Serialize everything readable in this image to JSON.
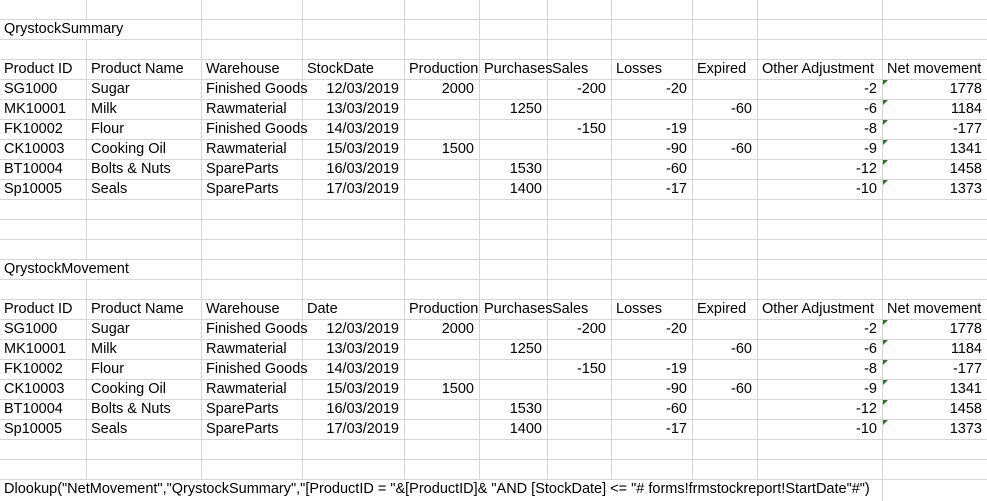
{
  "colors": {
    "gridline": "#d6d6d6",
    "flag_green": "#1e7b1e",
    "text": "#000000",
    "background": "#ffffff"
  },
  "icons": {
    "error_flag": "green-corner-triangle"
  },
  "sheet": {
    "tables": [
      {
        "title": "QrystockSummary",
        "headers": [
          "Product ID",
          "Product Name",
          "Warehouse",
          "StockDate",
          "Production",
          "Purchases",
          "Sales",
          "Losses",
          "Expired",
          "Other Adjustment",
          "Net movement"
        ],
        "rows": [
          [
            "SG1000",
            "Sugar",
            "Finished Goods",
            "12/03/2019",
            "2000",
            "",
            "-200",
            "-20",
            "",
            "-2",
            "1778"
          ],
          [
            "MK10001",
            "Milk",
            "Rawmaterial",
            "13/03/2019",
            "",
            "1250",
            "",
            "",
            "-60",
            "-6",
            "1184"
          ],
          [
            "FK10002",
            "Flour",
            "Finished Goods",
            "14/03/2019",
            "",
            "",
            "-150",
            "-19",
            "",
            "-8",
            "-177"
          ],
          [
            "CK10003",
            "Cooking Oil",
            "Rawmaterial",
            "15/03/2019",
            "1500",
            "",
            "",
            "-90",
            "-60",
            "-9",
            "1341"
          ],
          [
            "BT10004",
            "Bolts & Nuts",
            "SpareParts",
            "16/03/2019",
            "",
            "1530",
            "",
            "-60",
            "",
            "-12",
            "1458"
          ],
          [
            "Sp10005",
            "Seals",
            "SpareParts",
            "17/03/2019",
            "",
            "1400",
            "",
            "-17",
            "",
            "-10",
            "1373"
          ]
        ]
      },
      {
        "title": "QrystockMovement",
        "headers": [
          "Product ID",
          "Product Name",
          "Warehouse",
          "Date",
          "Production",
          "Purchases",
          "Sales",
          "Losses",
          "Expired",
          "Other Adjustment",
          "Net movement"
        ],
        "rows": [
          [
            "SG1000",
            "Sugar",
            "Finished Goods",
            "12/03/2019",
            "2000",
            "",
            "-200",
            "-20",
            "",
            "-2",
            "1778"
          ],
          [
            "MK10001",
            "Milk",
            "Rawmaterial",
            "13/03/2019",
            "",
            "1250",
            "",
            "",
            "-60",
            "-6",
            "1184"
          ],
          [
            "FK10002",
            "Flour",
            "Finished Goods",
            "14/03/2019",
            "",
            "",
            "-150",
            "-19",
            "",
            "-8",
            "-177"
          ],
          [
            "CK10003",
            "Cooking Oil",
            "Rawmaterial",
            "15/03/2019",
            "1500",
            "",
            "",
            "-90",
            "-60",
            "-9",
            "1341"
          ],
          [
            "BT10004",
            "Bolts & Nuts",
            "SpareParts",
            "16/03/2019",
            "",
            "1530",
            "",
            "-60",
            "",
            "-12",
            "1458"
          ],
          [
            "Sp10005",
            "Seals",
            "SpareParts",
            "17/03/2019",
            "",
            "1400",
            "",
            "-17",
            "",
            "-10",
            "1373"
          ]
        ]
      }
    ],
    "formula": "Dlookup(\"NetMovement\",\"QrystockSummary\",\"[ProductID = \"&[ProductID]& \"AND [StockDate] <= \"# forms!frmstockreport!StartDate\"#\")"
  }
}
